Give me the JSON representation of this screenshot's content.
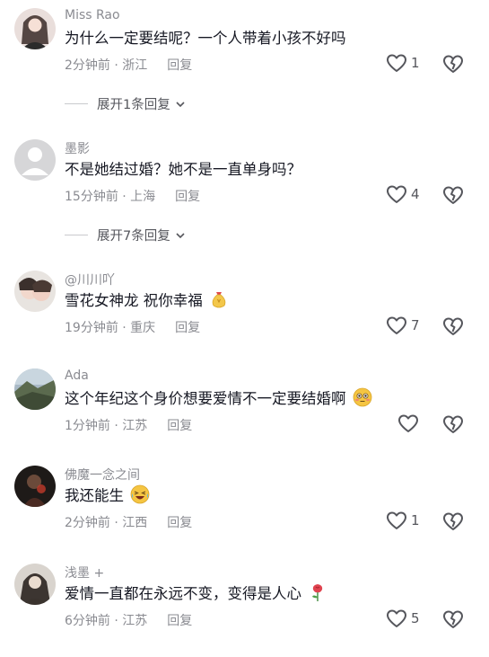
{
  "comments": [
    {
      "username": "Miss Rao",
      "text": "为什么一定要结呢？一个人带着小孩不好吗",
      "time_location": "2分钟前 · 浙江",
      "reply_label": "回复",
      "likes": "1",
      "expand_label": "展开1条回复",
      "emoji": ""
    },
    {
      "username": "墨影",
      "text": "不是她结过婚？她不是一直单身吗？",
      "time_location": "15分钟前 · 上海",
      "reply_label": "回复",
      "likes": "4",
      "expand_label": "展开7条回复",
      "emoji": ""
    },
    {
      "username": "@川川吖",
      "text": "雪花女神龙  祝你幸福",
      "time_location": "19分钟前 · 重庆",
      "reply_label": "回复",
      "likes": "7",
      "expand_label": "",
      "emoji": "money-bag"
    },
    {
      "username": "Ada",
      "text": "这个年纪这个身价想要爱情不一定要结婚啊",
      "time_location": "1分钟前 · 江苏",
      "reply_label": "回复",
      "likes": "",
      "expand_label": "",
      "emoji": "flushed-face"
    },
    {
      "username": "佛魔一念之间",
      "text": "我还能生",
      "time_location": "2分钟前 · 江西",
      "reply_label": "回复",
      "likes": "1",
      "expand_label": "",
      "emoji": "laughing-face"
    },
    {
      "username": "浅墨 +",
      "text": "爱情一直都在永远不变，变得是人心",
      "time_location": "6分钟前 · 江苏",
      "reply_label": "回复",
      "likes": "5",
      "expand_label": "",
      "emoji": "rose"
    }
  ],
  "colors": {
    "text": "#161823",
    "muted": "#8a8b91",
    "icon": "#55565c"
  }
}
